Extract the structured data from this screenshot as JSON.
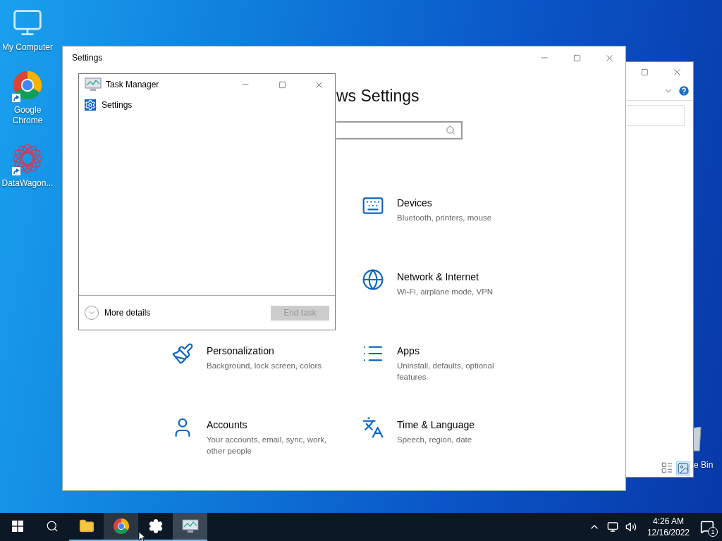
{
  "desktop_icons": [
    {
      "kind": "computer",
      "label": "My Computer",
      "shortcut": false
    },
    {
      "kind": "chrome",
      "label": "Google Chrome",
      "shortcut": true
    },
    {
      "kind": "datawagon",
      "label": "DataWagon...",
      "shortcut": true
    }
  ],
  "recycle_bin": {
    "label": "e Bin"
  },
  "settings_window": {
    "title": "Settings",
    "heading": "ws Settings",
    "category_columns": [
      [
        {
          "kind": "personalization",
          "title": "Personalization",
          "description": "Background, lock screen, colors"
        },
        {
          "kind": "accounts",
          "title": "Accounts",
          "description": "Your accounts, email, sync, work, other people"
        }
      ],
      [
        {
          "kind": "devices",
          "title": "Devices",
          "description": "Bluetooth, printers, mouse"
        },
        {
          "kind": "network",
          "title": "Network & Internet",
          "description": "Wi-Fi, airplane mode, VPN"
        },
        {
          "kind": "apps",
          "title": "Apps",
          "description": "Uninstall, defaults, optional features"
        },
        {
          "kind": "time",
          "title": "Time & Language",
          "description": "Speech, region, date"
        }
      ]
    ]
  },
  "task_manager": {
    "title": "Task Manager",
    "apps": [
      {
        "kind": "settings",
        "name": "Settings"
      }
    ],
    "more_details": "More details",
    "end_task": {
      "label": "End task",
      "disabled": true
    }
  },
  "taskbar": {
    "items": [
      {
        "kind": "start"
      },
      {
        "kind": "search"
      },
      {
        "kind": "explorer",
        "running": true,
        "selected": false
      },
      {
        "kind": "chrome",
        "running": true,
        "selected": false
      },
      {
        "kind": "settings",
        "running": true,
        "selected": false
      },
      {
        "kind": "taskmanager",
        "running": true,
        "selected": true
      }
    ],
    "clock": {
      "time": "4:26 AM",
      "date": "12/16/2022"
    },
    "notification_count": "1"
  }
}
